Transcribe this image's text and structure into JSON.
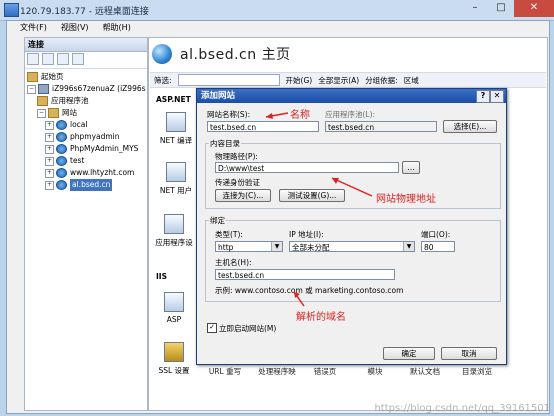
{
  "window": {
    "title": "120.79.183.77 - 远程桌面连接"
  },
  "menu": [
    {
      "label": "文件(F)"
    },
    {
      "label": "视图(V)"
    },
    {
      "label": "帮助(H)"
    }
  ],
  "left_pane": {
    "title": "连接",
    "tree": [
      {
        "label": "起始页",
        "indent": 0,
        "icon": "start-page-icon"
      },
      {
        "label": "iZ996s67zenuaZ (iZ996s",
        "indent": 0,
        "icon": "server-icon"
      },
      {
        "label": "应用程序池",
        "indent": 1,
        "icon": "app-pool-icon"
      },
      {
        "label": "网站",
        "indent": 1,
        "icon": "folder-icon"
      },
      {
        "label": "local",
        "indent": 2,
        "icon": "globe-icon"
      },
      {
        "label": "phpmyadmin",
        "indent": 2,
        "icon": "globe-icon"
      },
      {
        "label": "PhpMyAdmin_MYS",
        "indent": 2,
        "icon": "globe-icon"
      },
      {
        "label": "test",
        "indent": 2,
        "icon": "globe-icon"
      },
      {
        "label": "www.lhtyzht.com",
        "indent": 2,
        "icon": "globe-icon"
      },
      {
        "label": "al.bsed.cn",
        "indent": 2,
        "icon": "globe-icon",
        "selected": true
      }
    ]
  },
  "main": {
    "title": "al.bsed.cn 主页",
    "filter_label": "筛选:",
    "start_label": "开始(G)",
    "show_all_label": "全部显示(A)",
    "group_label": "分组依据:",
    "group_value": "区域",
    "section_aspnet": "ASP.NET",
    "section_iis": "IIS",
    "features": [
      {
        "label": "NET 编译"
      },
      {
        "label": "NET 用户"
      },
      {
        "label": "应用程序设"
      },
      {
        "label": "ASP"
      },
      {
        "label": "SSL 设置"
      }
    ],
    "bottom_labels": [
      "URL 重写",
      "处理程序映",
      "错误页",
      "模块",
      "默认文档",
      "目录浏览"
    ]
  },
  "dialog": {
    "title": "添加网站",
    "site_name_label": "网站名称(S):",
    "site_name_value": "test.bsed.cn",
    "app_pool_label": "应用程序池(L):",
    "app_pool_value": "test.bsed.cn",
    "select_button": "选择(E)...",
    "content_dir_label": "内容目录",
    "physical_path_label": "物理路径(P):",
    "physical_path_value": "D:\\www\\test",
    "browse_button": "...",
    "pass_auth_label": "传递身份验证",
    "connect_as_button": "连接为(C)...",
    "test_settings_button": "测试设置(G)...",
    "binding_label": "绑定",
    "type_label": "类型(T):",
    "type_value": "http",
    "ip_label": "IP 地址(I):",
    "ip_value": "全部未分配",
    "port_label": "端口(O):",
    "port_value": "80",
    "hostname_label": "主机名(H):",
    "hostname_value": "test.bsed.cn",
    "example_label": "示例: www.contoso.com 或 marketing.contoso.com",
    "start_checkbox_label": "立即启动网站(M)",
    "start_checkbox_checked": true,
    "ok_button": "确定",
    "cancel_button": "取消"
  },
  "annotations": {
    "name": "名称",
    "physical_path": "网站物理地址",
    "domain": "解析的域名"
  },
  "watermark": "https://blog.csdn.net/qq_39161501",
  "colors": {
    "accent": "#1a4da6",
    "annotation": "#e02020"
  }
}
